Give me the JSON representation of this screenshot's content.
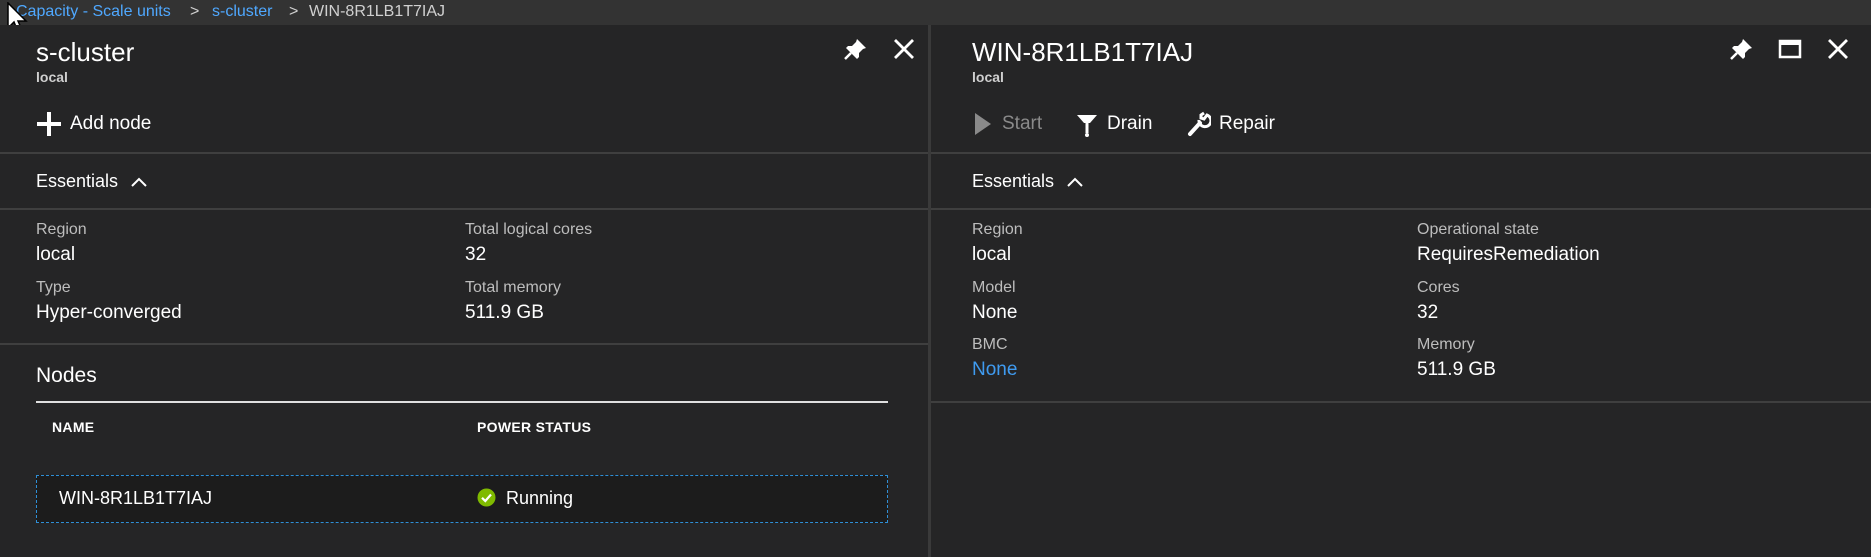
{
  "breadcrumb": {
    "items": [
      "Capacity - Scale units",
      "s-cluster"
    ],
    "current": "WIN-8R1LB1T7IAJ",
    "separator": ">"
  },
  "left_blade": {
    "title": "s-cluster",
    "subtitle": "local",
    "commands": {
      "add_node": "Add node"
    },
    "essentials": {
      "label": "Essentials",
      "region_label": "Region",
      "region_value": "local",
      "type_label": "Type",
      "type_value": "Hyper-converged",
      "cores_label": "Total logical cores",
      "cores_value": "32",
      "memory_label": "Total memory",
      "memory_value": "511.9 GB"
    },
    "nodes": {
      "title": "Nodes",
      "columns": [
        "NAME",
        "POWER STATUS"
      ],
      "rows": [
        {
          "name": "WIN-8R1LB1T7IAJ",
          "status": "Running"
        }
      ]
    }
  },
  "right_blade": {
    "title": "WIN-8R1LB1T7IAJ",
    "subtitle": "local",
    "commands": {
      "start": "Start",
      "drain": "Drain",
      "repair": "Repair"
    },
    "essentials": {
      "label": "Essentials",
      "region_label": "Region",
      "region_value": "local",
      "model_label": "Model",
      "model_value": "None",
      "bmc_label": "BMC",
      "bmc_value": "None",
      "state_label": "Operational state",
      "state_value": "RequiresRemediation",
      "cores_label": "Cores",
      "cores_value": "32",
      "memory_label": "Memory",
      "memory_value": "511.9 GB"
    }
  },
  "colors": {
    "accent_link": "#4fa8ff",
    "status_ok": "#7fba00",
    "selection_border": "#2f8fd6"
  },
  "icons": {
    "pin": "pin-icon",
    "close": "close-icon",
    "maximize": "maximize-icon",
    "add": "plus-icon",
    "start": "play-icon",
    "drain": "drain-icon",
    "repair": "wrench-icon",
    "collapse": "chevron-up-icon",
    "running": "check-circle-icon"
  }
}
